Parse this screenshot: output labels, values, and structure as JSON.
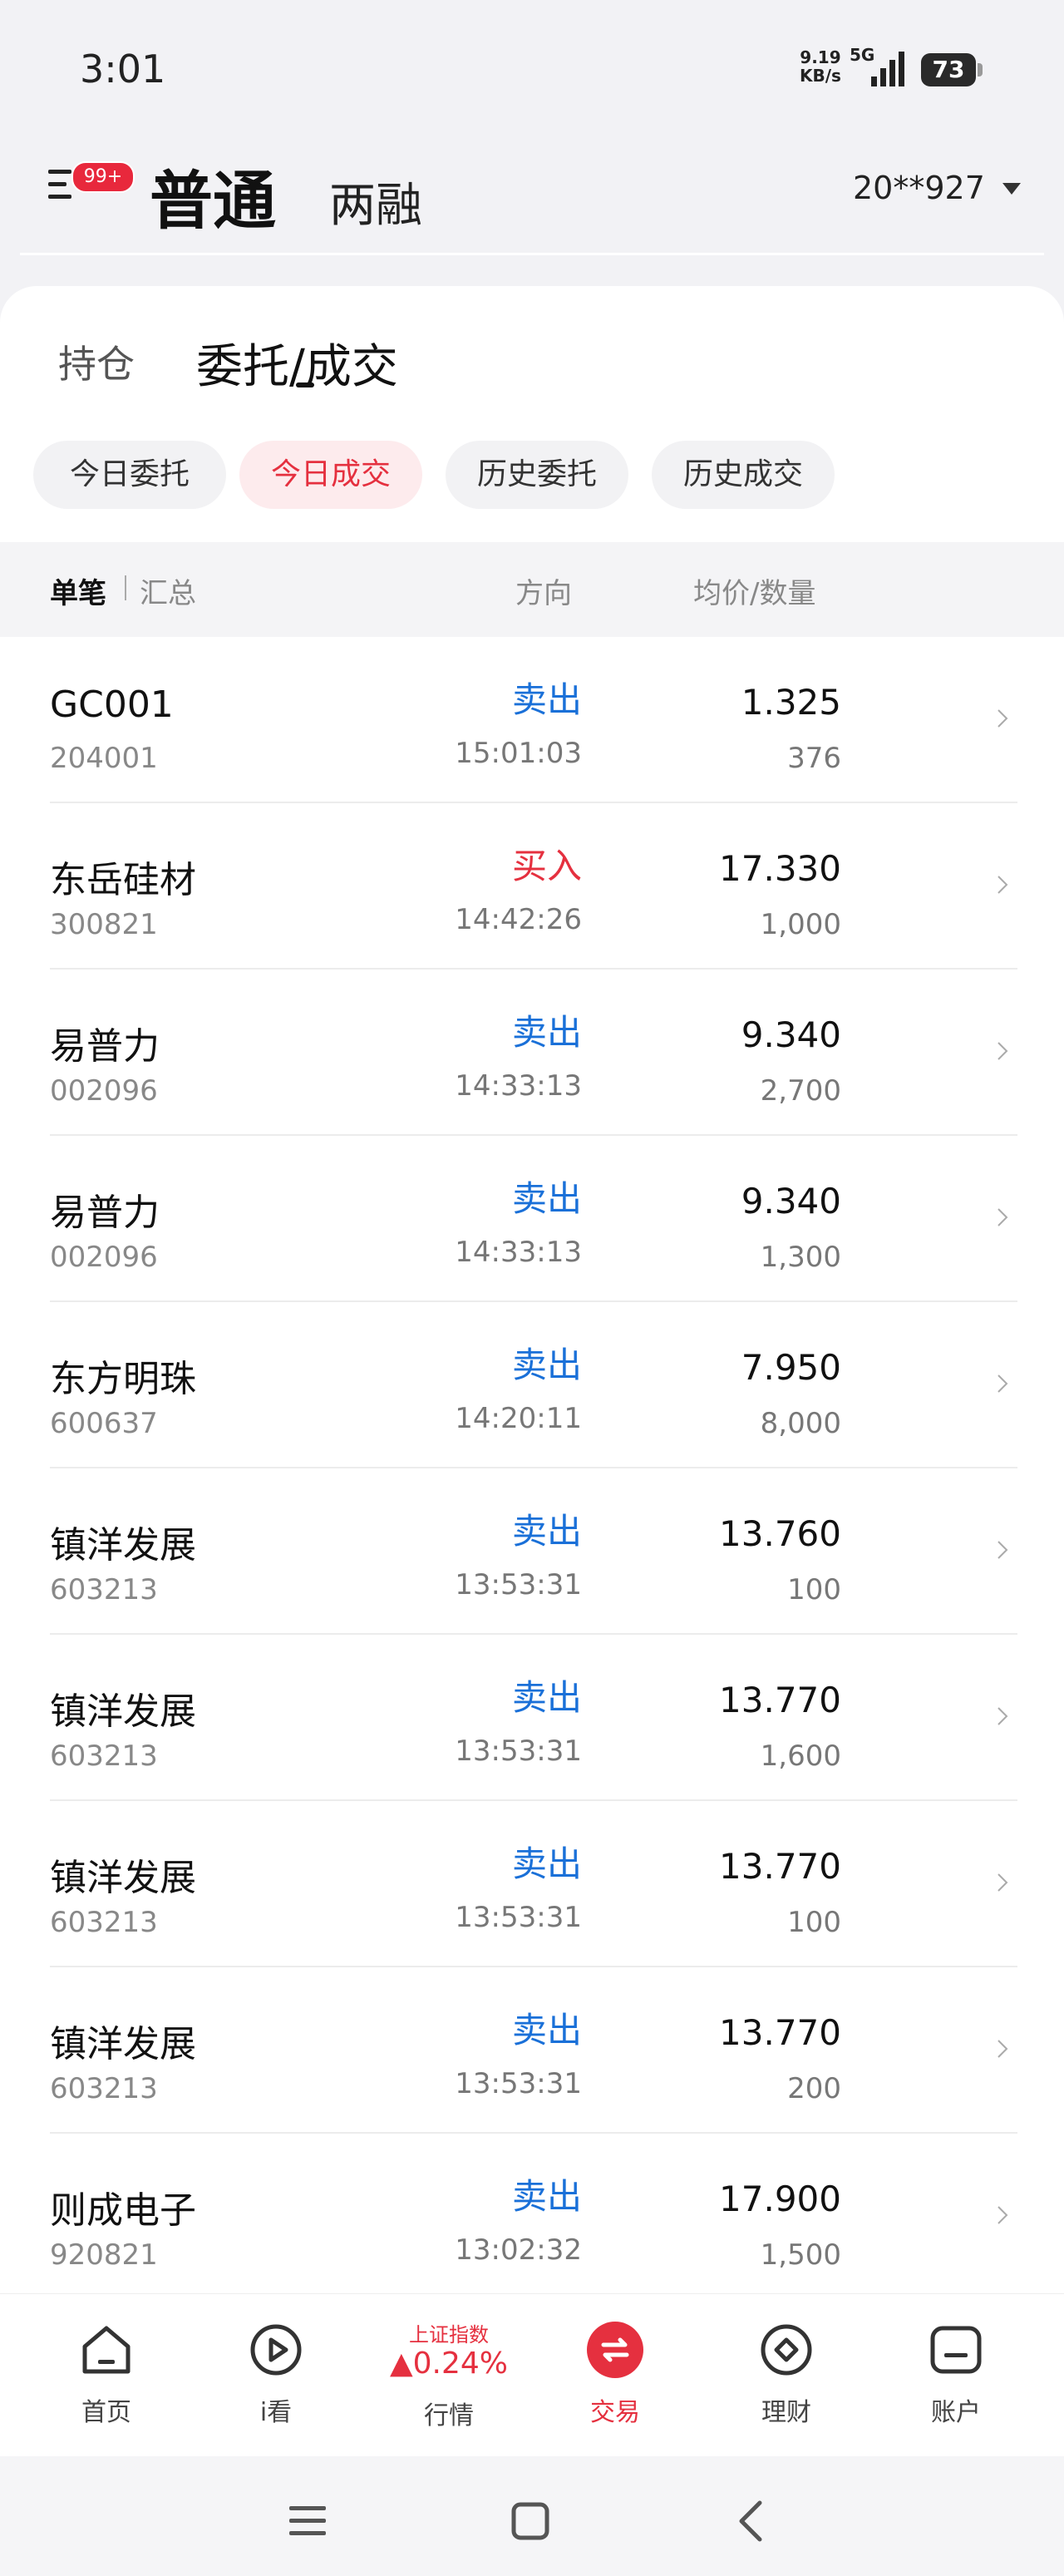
{
  "status_bar": {
    "time": "3:01",
    "net_speed": "9.19",
    "net_unit": "KB/s",
    "network": "5G",
    "battery": "73"
  },
  "header": {
    "badge": "99+",
    "tab_normal": "普通",
    "tab_margin": "两融",
    "account": "20**927"
  },
  "subtabs": {
    "hold": "持仓",
    "entrust": "委托/成交"
  },
  "filters": [
    {
      "label": "今日委托",
      "active": false
    },
    {
      "label": "今日成交",
      "active": true
    },
    {
      "label": "历史委托",
      "active": false
    },
    {
      "label": "历史成交",
      "active": false
    }
  ],
  "columns": {
    "single": "单笔",
    "summary": "汇总",
    "direction": "方向",
    "price_qty": "均价/数量"
  },
  "trades": [
    {
      "name": "GC001",
      "code": "204001",
      "direction": "卖出",
      "side": "sell",
      "time": "15:01:03",
      "price": "1.325",
      "qty": "376"
    },
    {
      "name": "东岳硅材",
      "code": "300821",
      "direction": "买入",
      "side": "buy",
      "time": "14:42:26",
      "price": "17.330",
      "qty": "1,000"
    },
    {
      "name": "易普力",
      "code": "002096",
      "direction": "卖出",
      "side": "sell",
      "time": "14:33:13",
      "price": "9.340",
      "qty": "2,700"
    },
    {
      "name": "易普力",
      "code": "002096",
      "direction": "卖出",
      "side": "sell",
      "time": "14:33:13",
      "price": "9.340",
      "qty": "1,300"
    },
    {
      "name": "东方明珠",
      "code": "600637",
      "direction": "卖出",
      "side": "sell",
      "time": "14:20:11",
      "price": "7.950",
      "qty": "8,000"
    },
    {
      "name": "镇洋发展",
      "code": "603213",
      "direction": "卖出",
      "side": "sell",
      "time": "13:53:31",
      "price": "13.760",
      "qty": "100"
    },
    {
      "name": "镇洋发展",
      "code": "603213",
      "direction": "卖出",
      "side": "sell",
      "time": "13:53:31",
      "price": "13.770",
      "qty": "1,600"
    },
    {
      "name": "镇洋发展",
      "code": "603213",
      "direction": "卖出",
      "side": "sell",
      "time": "13:53:31",
      "price": "13.770",
      "qty": "100"
    },
    {
      "name": "镇洋发展",
      "code": "603213",
      "direction": "卖出",
      "side": "sell",
      "time": "13:53:31",
      "price": "13.770",
      "qty": "200"
    },
    {
      "name": "则成电子",
      "code": "920821",
      "direction": "卖出",
      "side": "sell",
      "time": "13:02:32",
      "price": "17.900",
      "qty": "1,500"
    }
  ],
  "tabbar": {
    "home": "首页",
    "watch": "i看",
    "index_title": "上证指数",
    "index_value": "▲0.24%",
    "market": "行情",
    "trade": "交易",
    "wealth": "理财",
    "account": "账户"
  },
  "colors": {
    "accent_red": "#e5303f",
    "sell_blue": "#1a70d8"
  }
}
